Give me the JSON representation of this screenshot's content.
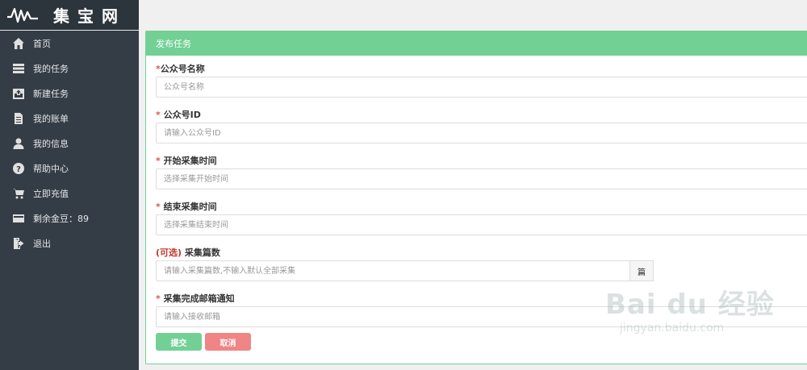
{
  "brand": {
    "name": "集宝网",
    "logo_icon": "waveform-logo-icon"
  },
  "sidebar": {
    "items": [
      {
        "label": "首页",
        "icon": "home-icon"
      },
      {
        "label": "我的任务",
        "icon": "list-icon"
      },
      {
        "label": "新建任务",
        "icon": "inbox-upload-icon"
      },
      {
        "label": "我的账单",
        "icon": "document-icon"
      },
      {
        "label": "我的信息",
        "icon": "user-icon"
      },
      {
        "label": "帮助中心",
        "icon": "help-icon"
      },
      {
        "label": "立即充值",
        "icon": "cart-icon"
      },
      {
        "label": "剩余金豆：89",
        "icon": "card-icon"
      },
      {
        "label": "退出",
        "icon": "logout-icon"
      }
    ]
  },
  "panel": {
    "title": "发布任务",
    "fields": {
      "account_name": {
        "label": "公众号名称",
        "required_mark": "*",
        "placeholder": "公众号名称"
      },
      "account_id": {
        "label": " 公众号ID",
        "required_mark": "*",
        "placeholder": "请输入公众号ID"
      },
      "start_time": {
        "label": " 开始采集时间",
        "required_mark": "*",
        "placeholder": "选择采集开始时间"
      },
      "end_time": {
        "label": " 结束采集时间",
        "required_mark": "*",
        "placeholder": "选择采集结束时间"
      },
      "article_count": {
        "optional_mark": "(可选)",
        "label": " 采集篇数",
        "placeholder": "请输入采集篇数,不输入默认全部采集",
        "addon": "篇"
      },
      "email": {
        "label": " 采集完成邮箱通知",
        "required_mark": "*",
        "placeholder": "请输入接收邮箱"
      }
    },
    "submit_label": "提交",
    "cancel_label": "取消"
  },
  "watermark": {
    "logo_text": "Bai du 经验",
    "url": "jingyan.baidu.com"
  },
  "colors": {
    "sidebar": "#343d46",
    "accent": "#72d095",
    "cancel": "#f08585",
    "required": "#d9534f"
  }
}
